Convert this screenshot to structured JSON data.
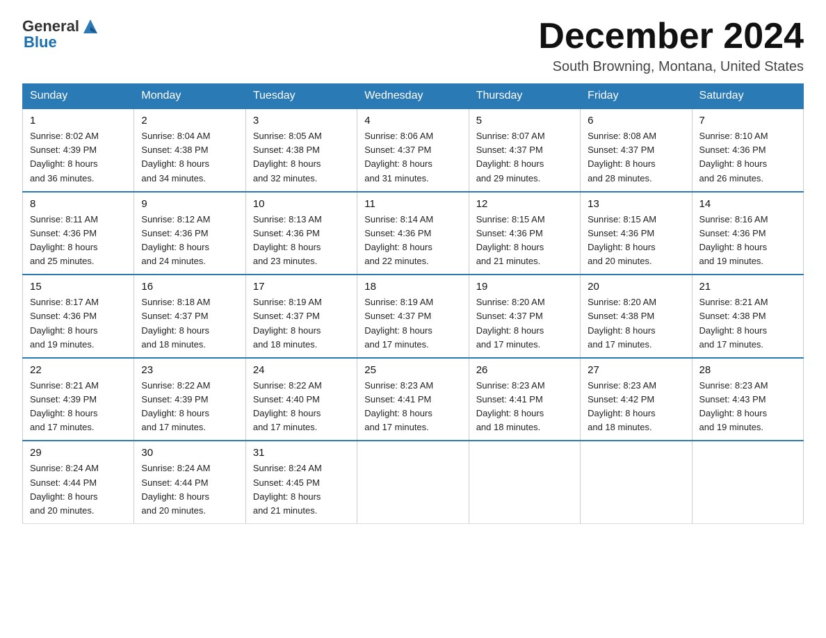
{
  "logo": {
    "text_general": "General",
    "text_blue": "Blue"
  },
  "title": "December 2024",
  "location": "South Browning, Montana, United States",
  "days_of_week": [
    "Sunday",
    "Monday",
    "Tuesday",
    "Wednesday",
    "Thursday",
    "Friday",
    "Saturday"
  ],
  "weeks": [
    [
      {
        "day": "1",
        "sunrise": "8:02 AM",
        "sunset": "4:39 PM",
        "daylight": "8 hours and 36 minutes."
      },
      {
        "day": "2",
        "sunrise": "8:04 AM",
        "sunset": "4:38 PM",
        "daylight": "8 hours and 34 minutes."
      },
      {
        "day": "3",
        "sunrise": "8:05 AM",
        "sunset": "4:38 PM",
        "daylight": "8 hours and 32 minutes."
      },
      {
        "day": "4",
        "sunrise": "8:06 AM",
        "sunset": "4:37 PM",
        "daylight": "8 hours and 31 minutes."
      },
      {
        "day": "5",
        "sunrise": "8:07 AM",
        "sunset": "4:37 PM",
        "daylight": "8 hours and 29 minutes."
      },
      {
        "day": "6",
        "sunrise": "8:08 AM",
        "sunset": "4:37 PM",
        "daylight": "8 hours and 28 minutes."
      },
      {
        "day": "7",
        "sunrise": "8:10 AM",
        "sunset": "4:36 PM",
        "daylight": "8 hours and 26 minutes."
      }
    ],
    [
      {
        "day": "8",
        "sunrise": "8:11 AM",
        "sunset": "4:36 PM",
        "daylight": "8 hours and 25 minutes."
      },
      {
        "day": "9",
        "sunrise": "8:12 AM",
        "sunset": "4:36 PM",
        "daylight": "8 hours and 24 minutes."
      },
      {
        "day": "10",
        "sunrise": "8:13 AM",
        "sunset": "4:36 PM",
        "daylight": "8 hours and 23 minutes."
      },
      {
        "day": "11",
        "sunrise": "8:14 AM",
        "sunset": "4:36 PM",
        "daylight": "8 hours and 22 minutes."
      },
      {
        "day": "12",
        "sunrise": "8:15 AM",
        "sunset": "4:36 PM",
        "daylight": "8 hours and 21 minutes."
      },
      {
        "day": "13",
        "sunrise": "8:15 AM",
        "sunset": "4:36 PM",
        "daylight": "8 hours and 20 minutes."
      },
      {
        "day": "14",
        "sunrise": "8:16 AM",
        "sunset": "4:36 PM",
        "daylight": "8 hours and 19 minutes."
      }
    ],
    [
      {
        "day": "15",
        "sunrise": "8:17 AM",
        "sunset": "4:36 PM",
        "daylight": "8 hours and 19 minutes."
      },
      {
        "day": "16",
        "sunrise": "8:18 AM",
        "sunset": "4:37 PM",
        "daylight": "8 hours and 18 minutes."
      },
      {
        "day": "17",
        "sunrise": "8:19 AM",
        "sunset": "4:37 PM",
        "daylight": "8 hours and 18 minutes."
      },
      {
        "day": "18",
        "sunrise": "8:19 AM",
        "sunset": "4:37 PM",
        "daylight": "8 hours and 17 minutes."
      },
      {
        "day": "19",
        "sunrise": "8:20 AM",
        "sunset": "4:37 PM",
        "daylight": "8 hours and 17 minutes."
      },
      {
        "day": "20",
        "sunrise": "8:20 AM",
        "sunset": "4:38 PM",
        "daylight": "8 hours and 17 minutes."
      },
      {
        "day": "21",
        "sunrise": "8:21 AM",
        "sunset": "4:38 PM",
        "daylight": "8 hours and 17 minutes."
      }
    ],
    [
      {
        "day": "22",
        "sunrise": "8:21 AM",
        "sunset": "4:39 PM",
        "daylight": "8 hours and 17 minutes."
      },
      {
        "day": "23",
        "sunrise": "8:22 AM",
        "sunset": "4:39 PM",
        "daylight": "8 hours and 17 minutes."
      },
      {
        "day": "24",
        "sunrise": "8:22 AM",
        "sunset": "4:40 PM",
        "daylight": "8 hours and 17 minutes."
      },
      {
        "day": "25",
        "sunrise": "8:23 AM",
        "sunset": "4:41 PM",
        "daylight": "8 hours and 17 minutes."
      },
      {
        "day": "26",
        "sunrise": "8:23 AM",
        "sunset": "4:41 PM",
        "daylight": "8 hours and 18 minutes."
      },
      {
        "day": "27",
        "sunrise": "8:23 AM",
        "sunset": "4:42 PM",
        "daylight": "8 hours and 18 minutes."
      },
      {
        "day": "28",
        "sunrise": "8:23 AM",
        "sunset": "4:43 PM",
        "daylight": "8 hours and 19 minutes."
      }
    ],
    [
      {
        "day": "29",
        "sunrise": "8:24 AM",
        "sunset": "4:44 PM",
        "daylight": "8 hours and 20 minutes."
      },
      {
        "day": "30",
        "sunrise": "8:24 AM",
        "sunset": "4:44 PM",
        "daylight": "8 hours and 20 minutes."
      },
      {
        "day": "31",
        "sunrise": "8:24 AM",
        "sunset": "4:45 PM",
        "daylight": "8 hours and 21 minutes."
      },
      null,
      null,
      null,
      null
    ]
  ],
  "labels": {
    "sunrise": "Sunrise:",
    "sunset": "Sunset:",
    "daylight": "Daylight:"
  }
}
